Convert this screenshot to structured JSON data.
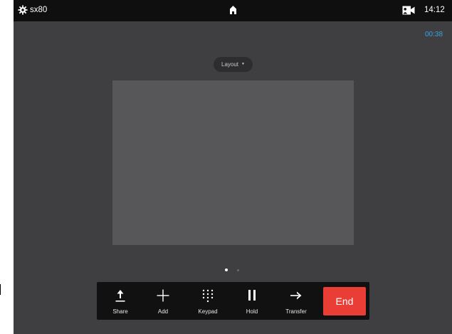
{
  "statusbar": {
    "device_name": "sx80",
    "time": "14:12",
    "icons": [
      "gear-icon",
      "home-icon",
      "self-view-camera-icon"
    ]
  },
  "call": {
    "duration": "00:38"
  },
  "layout_button": {
    "label": "Layout",
    "icon": "caret-down-icon"
  },
  "pager": {
    "pages": 2,
    "active": 1
  },
  "controls": {
    "share": "Share",
    "add": "Add",
    "keypad": "Keypad",
    "hold": "Hold",
    "transfer": "Transfer",
    "end": "End"
  },
  "colors": {
    "background": "#3f3f41",
    "topbar": "#0f0f10",
    "timer": "#3aa3e3",
    "end_button": "#ea3d35",
    "video_area": "#575759"
  }
}
